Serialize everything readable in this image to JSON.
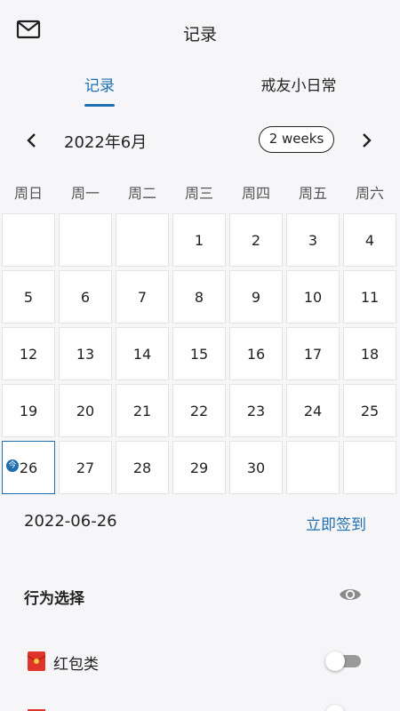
{
  "header": {
    "title": "记录",
    "mail_icon": "mail-icon"
  },
  "tabs": [
    {
      "label": "记录",
      "active": true
    },
    {
      "label": "戒友小日常",
      "active": false
    }
  ],
  "calendar": {
    "month_label": "2022年6月",
    "view_toggle_label": "2 weeks",
    "prev_icon": "chevron-left-icon",
    "next_icon": "chevron-right-icon",
    "weekdays": [
      "周日",
      "周一",
      "周二",
      "周三",
      "周四",
      "周五",
      "周六"
    ],
    "weeks": [
      [
        "",
        "",
        "",
        "1",
        "2",
        "3",
        "4"
      ],
      [
        "5",
        "6",
        "7",
        "8",
        "9",
        "10",
        "11"
      ],
      [
        "12",
        "13",
        "14",
        "15",
        "16",
        "17",
        "18"
      ],
      [
        "19",
        "20",
        "21",
        "22",
        "23",
        "24",
        "25"
      ],
      [
        "26",
        "27",
        "28",
        "29",
        "30",
        "",
        ""
      ]
    ],
    "selected_day": "26",
    "selected_marker": "今",
    "accent_color": "#1f6fb0"
  },
  "selected_date": {
    "date": "2022-06-26",
    "checkin_label": "立即签到"
  },
  "behavior": {
    "title": "行为选择",
    "visibility_icon": "eye-icon",
    "items": [
      {
        "label": "红包类",
        "icon": "red-envelope-icon",
        "enabled": false
      }
    ]
  }
}
